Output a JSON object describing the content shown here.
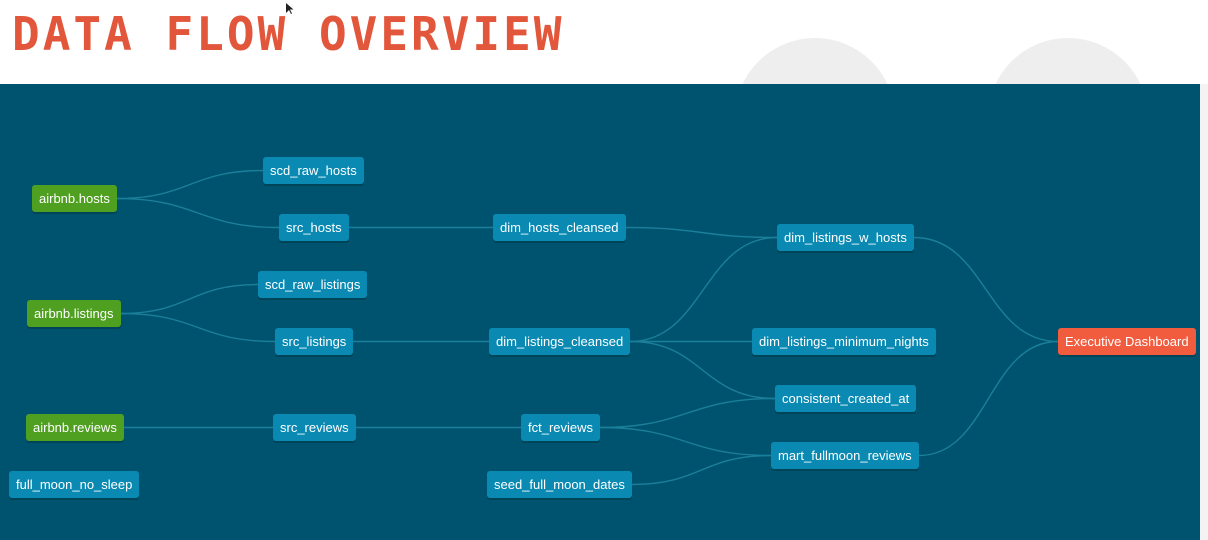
{
  "title": "DATA FLOW OVERVIEW",
  "colors": {
    "background": "#00536e",
    "title": "#e2573b",
    "source_node": "#4fa020",
    "model_node": "#0a8ab3",
    "exposure_node": "#f15c3e",
    "edge": "#1b7f9b"
  },
  "nodes": {
    "airbnb_hosts": "airbnb.hosts",
    "airbnb_listings": "airbnb.listings",
    "airbnb_reviews": "airbnb.reviews",
    "full_moon_no_sleep": "full_moon_no_sleep",
    "scd_raw_hosts": "scd_raw_hosts",
    "src_hosts": "src_hosts",
    "scd_raw_listings": "scd_raw_listings",
    "src_listings": "src_listings",
    "src_reviews": "src_reviews",
    "dim_hosts_cleansed": "dim_hosts_cleansed",
    "dim_listings_cleansed": "dim_listings_cleansed",
    "fct_reviews": "fct_reviews",
    "seed_full_moon_dates": "seed_full_moon_dates",
    "dim_listings_w_hosts": "dim_listings_w_hosts",
    "dim_listings_minimum_nights": "dim_listings_minimum_nights",
    "consistent_created_at": "consistent_created_at",
    "mart_fullmoon_reviews": "mart_fullmoon_reviews",
    "executive_dashboard": "Executive Dashboard"
  },
  "edges": [
    [
      "airbnb_hosts",
      "scd_raw_hosts"
    ],
    [
      "airbnb_hosts",
      "src_hosts"
    ],
    [
      "airbnb_listings",
      "scd_raw_listings"
    ],
    [
      "airbnb_listings",
      "src_listings"
    ],
    [
      "airbnb_reviews",
      "src_reviews"
    ],
    [
      "src_hosts",
      "dim_hosts_cleansed"
    ],
    [
      "src_listings",
      "dim_listings_cleansed"
    ],
    [
      "src_reviews",
      "fct_reviews"
    ],
    [
      "dim_hosts_cleansed",
      "dim_listings_w_hosts"
    ],
    [
      "dim_listings_cleansed",
      "dim_listings_w_hosts"
    ],
    [
      "dim_listings_cleansed",
      "dim_listings_minimum_nights"
    ],
    [
      "dim_listings_cleansed",
      "consistent_created_at"
    ],
    [
      "fct_reviews",
      "consistent_created_at"
    ],
    [
      "fct_reviews",
      "mart_fullmoon_reviews"
    ],
    [
      "seed_full_moon_dates",
      "mart_fullmoon_reviews"
    ],
    [
      "dim_listings_w_hosts",
      "executive_dashboard"
    ],
    [
      "mart_fullmoon_reviews",
      "executive_dashboard"
    ]
  ]
}
